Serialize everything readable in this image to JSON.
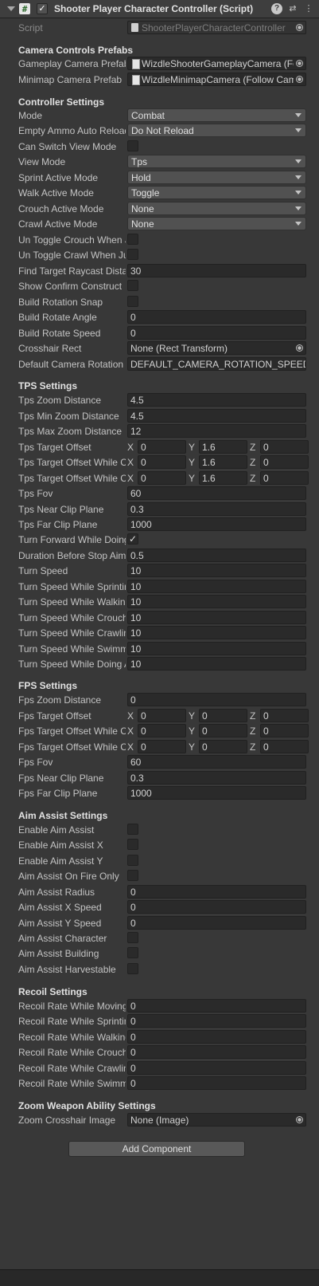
{
  "component": {
    "title": "Shooter Player Character Controller (Script)",
    "script_label": "Script",
    "script_value": "ShooterPlayerCharacterController"
  },
  "camera_prefabs": {
    "title": "Camera Controls Prefabs",
    "gameplay_label": "Gameplay Camera Prefab",
    "gameplay_value": "WizdleShooterGameplayCamera (Follow Camera)",
    "minimap_label": "Minimap Camera Prefab",
    "minimap_value": "WizdleMinimapCamera (Follow Camera)"
  },
  "controller": {
    "title": "Controller Settings",
    "mode_label": "Mode",
    "mode_value": "Combat",
    "empty_ammo_label": "Empty Ammo Auto Reload",
    "empty_ammo_value": "Do Not Reload",
    "can_switch_label": "Can Switch View Mode",
    "view_mode_label": "View Mode",
    "view_mode_value": "Tps",
    "sprint_label": "Sprint Active Mode",
    "sprint_value": "Hold",
    "walk_label": "Walk Active Mode",
    "walk_value": "Toggle",
    "crouch_label": "Crouch Active Mode",
    "crouch_value": "None",
    "crawl_label": "Crawl Active Mode",
    "crawl_value": "None",
    "untoggle_crouch_label": "Un Toggle Crouch When Jump",
    "untoggle_crawl_label": "Un Toggle Crawl When Jump",
    "raycast_label": "Find Target Raycast Distance",
    "raycast_value": "30",
    "confirm_label": "Show Confirm Construct",
    "snap_label": "Build Rotation Snap",
    "rotate_angle_label": "Build Rotate Angle",
    "rotate_angle_value": "0",
    "rotate_speed_label": "Build Rotate Speed",
    "rotate_speed_value": "0",
    "crosshair_label": "Crosshair Rect",
    "crosshair_value": "None (Rect Transform)",
    "cam_rot_label": "Default Camera Rotation Speed",
    "cam_rot_value": "DEFAULT_CAMERA_ROTATION_SPEED_SCALE"
  },
  "tps": {
    "title": "TPS Settings",
    "zoom_label": "Tps Zoom Distance",
    "zoom_value": "4.5",
    "min_zoom_label": "Tps Min Zoom Distance",
    "min_zoom_value": "4.5",
    "max_zoom_label": "Tps Max Zoom Distance",
    "max_zoom_value": "12",
    "offset_label": "Tps Target Offset",
    "offset": {
      "x": "0",
      "y": "1.6",
      "z": "0"
    },
    "offset_crouch_label": "Tps Target Offset While Crouching",
    "offset_crouch": {
      "x": "0",
      "y": "1.6",
      "z": "0"
    },
    "offset_crawl_label": "Tps Target Offset While Crawling",
    "offset_crawl": {
      "x": "0",
      "y": "1.6",
      "z": "0"
    },
    "fov_label": "Tps Fov",
    "fov_value": "60",
    "near_label": "Tps Near Clip Plane",
    "near_value": "0.3",
    "far_label": "Tps Far Clip Plane",
    "far_value": "1000",
    "turn_forward_label": "Turn Forward While Doing Action",
    "duration_label": "Duration Before Stop Aiming",
    "duration_value": "0.5",
    "turn_speed_label": "Turn Speed",
    "turn_speed_value": "10",
    "ts_sprint_label": "Turn Speed While Sprinting",
    "ts_sprint_value": "10",
    "ts_walk_label": "Turn Speed While Walking",
    "ts_walk_value": "10",
    "ts_crouch_label": "Turn Speed While Crouching",
    "ts_crouch_value": "10",
    "ts_crawl_label": "Turn Speed While Crawling",
    "ts_crawl_value": "10",
    "ts_swim_label": "Turn Speed While Swimming",
    "ts_swim_value": "10",
    "ts_doing_label": "Turn Speed While Doing Action",
    "ts_doing_value": "10"
  },
  "fps": {
    "title": "FPS Settings",
    "zoom_label": "Fps Zoom Distance",
    "zoom_value": "0",
    "offset_label": "Fps Target Offset",
    "offset": {
      "x": "0",
      "y": "0",
      "z": "0"
    },
    "offset_crouch_label": "Fps Target Offset While Crouching",
    "offset_crouch": {
      "x": "0",
      "y": "0",
      "z": "0"
    },
    "offset_crawl_label": "Fps Target Offset While Crawling",
    "offset_crawl": {
      "x": "0",
      "y": "0",
      "z": "0"
    },
    "fov_label": "Fps Fov",
    "fov_value": "60",
    "near_label": "Fps Near Clip Plane",
    "near_value": "0.3",
    "far_label": "Fps Far Clip Plane",
    "far_value": "1000"
  },
  "aim_assist": {
    "title": "Aim Assist Settings",
    "enable_label": "Enable Aim Assist",
    "enable_x_label": "Enable Aim Assist X",
    "enable_y_label": "Enable Aim Assist Y",
    "fire_only_label": "Aim Assist On Fire Only",
    "radius_label": "Aim Assist Radius",
    "radius_value": "0",
    "x_speed_label": "Aim Assist X Speed",
    "x_speed_value": "0",
    "y_speed_label": "Aim Assist Y Speed",
    "y_speed_value": "0",
    "character_label": "Aim Assist Character",
    "building_label": "Aim Assist Building",
    "harvestable_label": "Aim Assist Harvestable"
  },
  "recoil": {
    "title": "Recoil Settings",
    "moving_label": "Recoil Rate While Moving",
    "moving_value": "0",
    "sprinting_label": "Recoil Rate While Sprinting",
    "sprinting_value": "0",
    "walking_label": "Recoil Rate While Walking",
    "walking_value": "0",
    "crouching_label": "Recoil Rate While Crouching",
    "crouching_value": "0",
    "crawling_label": "Recoil Rate While Crawling",
    "crawling_value": "0",
    "swimming_label": "Recoil Rate While Swimming",
    "swimming_value": "0"
  },
  "zoom_weapon": {
    "title": "Zoom Weapon Ability Settings",
    "crosshair_label": "Zoom Crosshair Image",
    "crosshair_value": "None (Image)"
  },
  "add_component_label": "Add Component",
  "glyphs": {
    "script_icon": "#",
    "check": "✓",
    "help": "?",
    "presets": "⇄",
    "more": "⋮"
  },
  "theme": {
    "background": "#383838",
    "field": "#2a2a2a",
    "dropdown": "#515151"
  }
}
